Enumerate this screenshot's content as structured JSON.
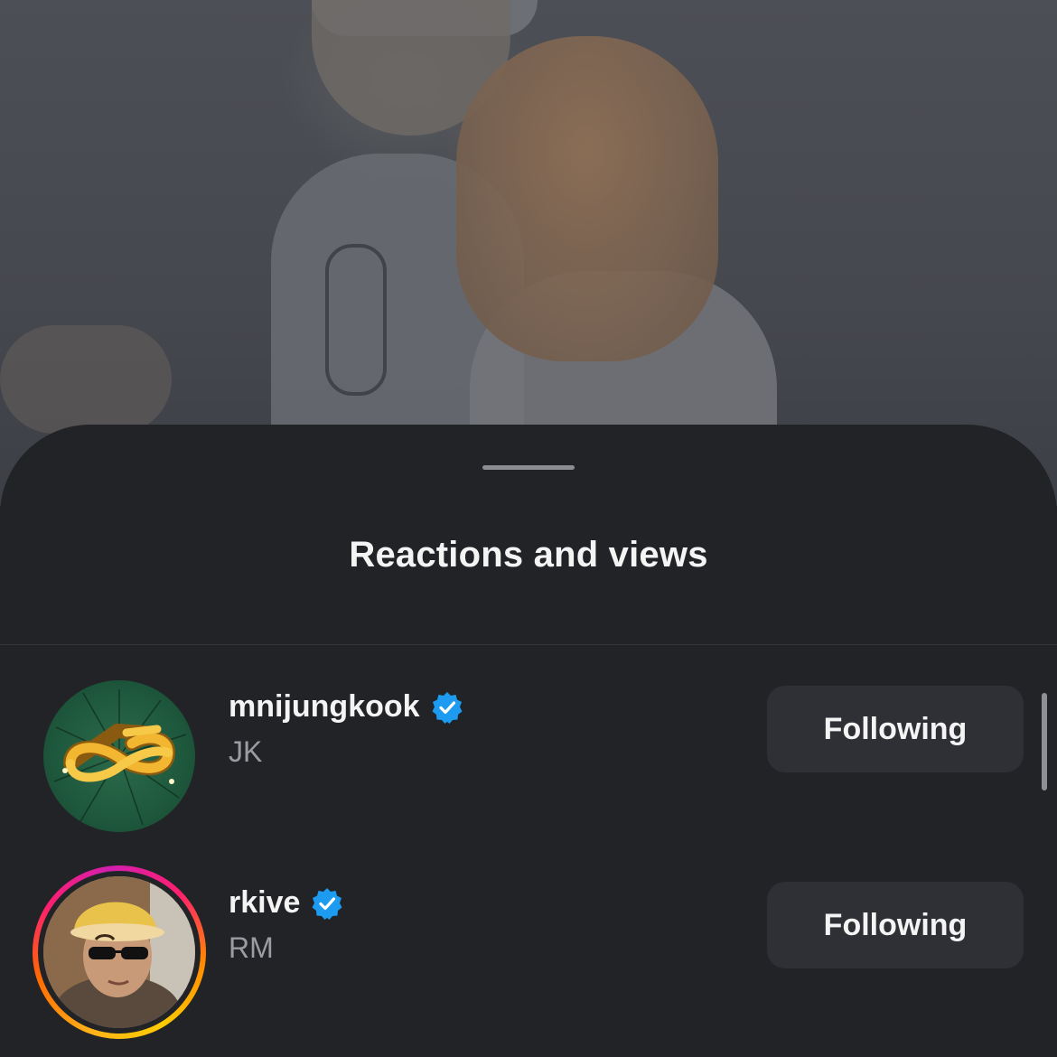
{
  "sheet": {
    "title": "Reactions and views"
  },
  "viewers": [
    {
      "username": "mnijungkook",
      "display_name": "JK",
      "verified": true,
      "has_story_ring": false,
      "button_label": "Following",
      "avatar_icon": "golden-infinity-logo"
    },
    {
      "username": "rkive",
      "display_name": "RM",
      "verified": true,
      "has_story_ring": true,
      "button_label": "Following",
      "avatar_icon": "person-photo"
    }
  ],
  "colors": {
    "sheet_background": "#222327",
    "verified_blue": "#1d9bf0",
    "button_background": "#2e3036",
    "secondary_text": "#9a9ca2"
  }
}
